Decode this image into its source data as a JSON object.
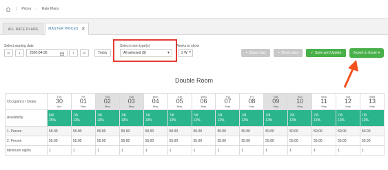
{
  "breadcrumb": {
    "items": [
      "Prices",
      "Rate Plans"
    ]
  },
  "tabs": [
    {
      "label": "ALL RATE PLANS"
    },
    {
      "label": "MASTER PRICES"
    }
  ],
  "controls": {
    "start_date_label": "Select starting date",
    "start_date_value": "2020-04-30",
    "today_label": "Today",
    "room_types_label": "Select room type(s)",
    "room_types_value": "All selected (9)",
    "weeks_label": "Weeks to show",
    "weeks_value": "2 W",
    "show_rows_label": "Show rows",
    "show_rules_label": "Show rules",
    "save_label": "Save and Update",
    "export_label": "Export to Excel"
  },
  "colors": {
    "availability": "#2bb58c",
    "save": "#4ab04a",
    "highlight": "#e53935",
    "annotation_arrow": "#f4511e"
  },
  "room_title": "Double Room",
  "grid": {
    "header_label": "Occupancy / Dates",
    "days": [
      {
        "dow": "Thu",
        "day": "30",
        "month": "Apr",
        "weekend": false
      },
      {
        "dow": "Fri",
        "day": "01",
        "month": "May",
        "weekend": false
      },
      {
        "dow": "Sat",
        "day": "02",
        "month": "May",
        "weekend": true
      },
      {
        "dow": "Sun",
        "day": "03",
        "month": "May",
        "weekend": true
      },
      {
        "dow": "Mon",
        "day": "04",
        "month": "May",
        "weekend": false
      },
      {
        "dow": "Tue",
        "day": "05",
        "month": "May",
        "weekend": false
      },
      {
        "dow": "Wed",
        "day": "06",
        "month": "May",
        "weekend": false
      },
      {
        "dow": "Thu",
        "day": "07",
        "month": "May",
        "weekend": false
      },
      {
        "dow": "Fri",
        "day": "08",
        "month": "May",
        "weekend": false
      },
      {
        "dow": "Sat",
        "day": "09",
        "month": "May",
        "weekend": true
      },
      {
        "dow": "Sun",
        "day": "10",
        "month": "May",
        "weekend": true
      },
      {
        "dow": "Mon",
        "day": "11",
        "month": "May",
        "weekend": false
      },
      {
        "dow": "Tue",
        "day": "12",
        "month": "May",
        "weekend": false
      },
      {
        "dow": "Wed",
        "day": "13",
        "month": "May",
        "weekend": false
      }
    ],
    "rows": [
      {
        "label": "Availability",
        "type": "avail",
        "cells": [
          "6/8|25%",
          "7/8|13%",
          "7/8|13%",
          "7/8|13%",
          "7/8|13%",
          "7/8|13%",
          "7/8|13%",
          "7/8|13%",
          "7/8|13%",
          "7/8|13%",
          "7/8|13%",
          "7/8|13%",
          "7/8|13%",
          "7/8|13%"
        ]
      },
      {
        "label": "1. Person",
        "type": "shade",
        "cells": [
          "50.00",
          "50.00",
          "50.00",
          "50.00",
          "50.00",
          "50.00",
          "50.00",
          "50.00",
          "50.00",
          "50.00",
          "50.00",
          "50.00",
          "50.00",
          "50.00"
        ]
      },
      {
        "label": "2. Person",
        "type": "plain",
        "cells": [
          "55.00",
          "55.00",
          "55.00",
          "55.00",
          "55.00",
          "55.00",
          "55.00",
          "55.00",
          "55.00",
          "55.00",
          "55.00",
          "55.00",
          "55.00",
          "55.00"
        ]
      },
      {
        "label": "Minimum nights",
        "type": "plain",
        "cells": [
          "1",
          "1",
          "1",
          "1",
          "1",
          "1",
          "1",
          "1",
          "1",
          "1",
          "1",
          "1",
          "1",
          "1"
        ]
      }
    ]
  }
}
